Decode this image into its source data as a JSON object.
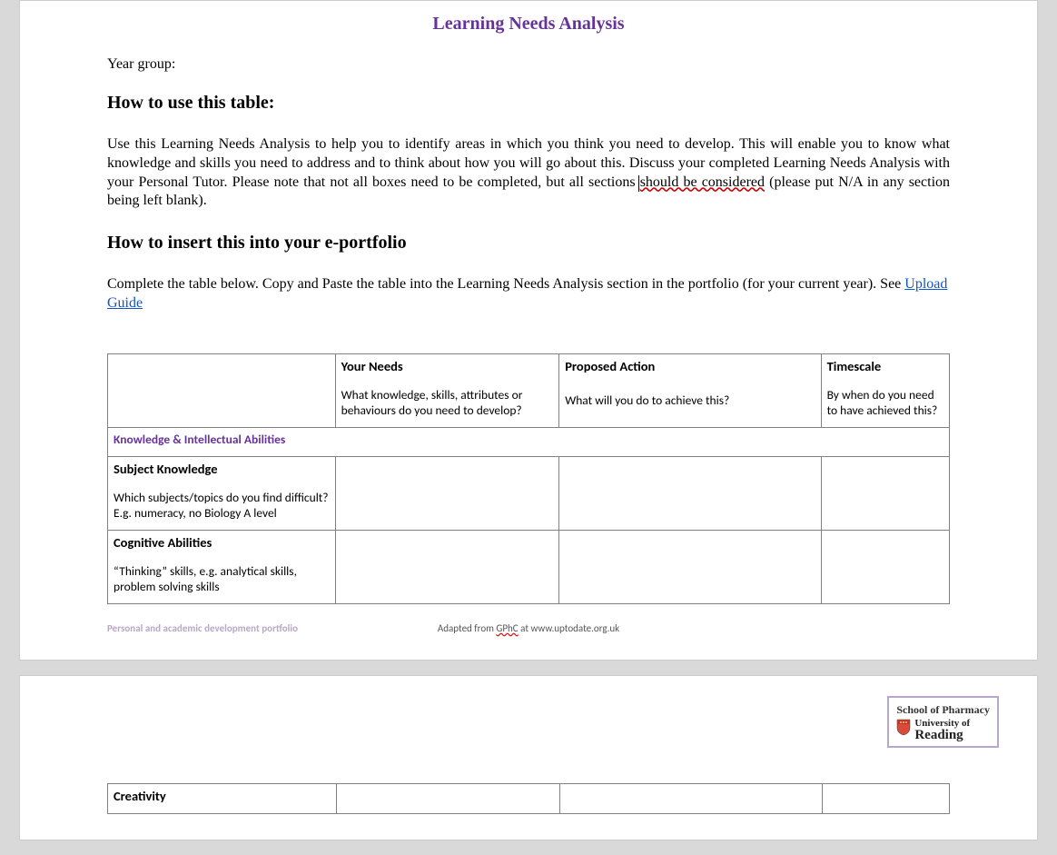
{
  "title": "Learning Needs Analysis",
  "year_group_label": "Year group:",
  "h_howuse": "How to use this table:",
  "body_howuse_1": "Use this Learning Needs Analysis to help you to identify areas in which you think you need to develop.  This will enable you to know what knowledge and skills you need to address and to think about how you will go about this.  Discuss your completed Learning Needs Analysis with your Personal Tutor. Please note that not all boxes need to be completed, but all sections ",
  "body_howuse_spell": "should be considered",
  "body_howuse_2": " (please put N/A in any section being left blank).",
  "h_insert": "How to insert this into your e-portfolio",
  "body_insert_1": "Complete the table below. Copy and Paste the table into the Learning Needs Analysis section in the portfolio (for your current year). See ",
  "link_upload": "Upload Guide",
  "table": {
    "headers": {
      "needs_title": "Your Needs",
      "needs_sub": "What knowledge, skills, attributes or behaviours do you need to develop?",
      "action_title": "Proposed Action",
      "action_sub": "What will you do to achieve this?",
      "time_title": "Timescale",
      "time_sub": "By when do you need to have achieved this?"
    },
    "section1": "Knowledge & Intellectual Abilities",
    "row_subject_title": "Subject Knowledge",
    "row_subject_sub": "Which subjects/topics do you find difficult? E.g. numeracy, no Biology A level",
    "row_cognitive_title": "Cognitive Abilities",
    "row_cognitive_sub": "“Thinking” skills, e.g. analytical skills, problem solving skills",
    "row_creativity_title": "Creativity"
  },
  "footer": {
    "left": "Personal and academic development portfolio",
    "center_1": "Adapted from ",
    "center_spell": "GPhC",
    "center_2": " at www.uptodate.org.uk"
  },
  "logo": {
    "school": "School of Pharmacy",
    "uni1": "University of",
    "uni2": "Reading"
  }
}
